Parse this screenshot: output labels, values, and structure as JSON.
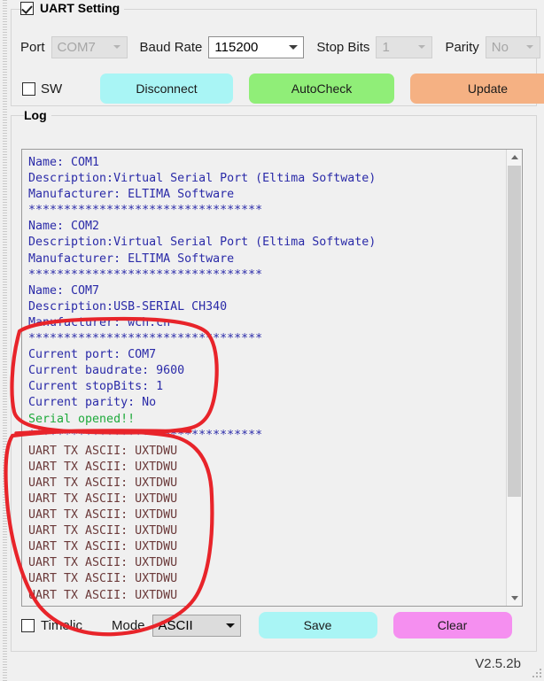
{
  "window": {
    "version_label": "V2.5.2b"
  },
  "uart_group": {
    "title": "UART Setting",
    "enabled_checkbox_checked": true,
    "fields": [
      {
        "label": "Port",
        "value": "COM7",
        "disabled": true,
        "name": "port"
      },
      {
        "label": "Baud Rate",
        "value": "115200",
        "disabled": false,
        "name": "baud-rate"
      },
      {
        "label": "Stop Bits",
        "value": "1",
        "disabled": true,
        "name": "stop-bits"
      },
      {
        "label": "Parity",
        "value": "No",
        "disabled": true,
        "name": "parity"
      }
    ],
    "sw_checkbox": {
      "label": "SW",
      "checked": false
    },
    "buttons": [
      {
        "label": "Disconnect",
        "color": "#a9f5f5"
      },
      {
        "label": "AutoCheck",
        "color": "#90ee78"
      },
      {
        "label": "Update",
        "color": "#f5b183"
      }
    ]
  },
  "log_group": {
    "title": "Log",
    "lines": [
      {
        "text": "Name: COM1",
        "color": "blue"
      },
      {
        "text": "Description:Virtual Serial Port (Eltima Softwate)",
        "color": "blue"
      },
      {
        "text": "Manufacturer: ELTIMA Software",
        "color": "blue"
      },
      {
        "text": "*********************************",
        "color": "blue"
      },
      {
        "text": "Name: COM2",
        "color": "blue"
      },
      {
        "text": "Description:Virtual Serial Port (Eltima Softwate)",
        "color": "blue"
      },
      {
        "text": "Manufacturer: ELTIMA Software",
        "color": "blue"
      },
      {
        "text": "*********************************",
        "color": "blue"
      },
      {
        "text": "Name: COM7",
        "color": "blue"
      },
      {
        "text": "Description:USB-SERIAL CH340",
        "color": "blue"
      },
      {
        "text": "Manufacturer: wch.cn",
        "color": "blue"
      },
      {
        "text": "*********************************",
        "color": "blue"
      },
      {
        "text": "Current port: COM7",
        "color": "blue"
      },
      {
        "text": "Current baudrate: 9600",
        "color": "blue"
      },
      {
        "text": "Current stopBits: 1",
        "color": "blue"
      },
      {
        "text": "Current parity: No",
        "color": "blue"
      },
      {
        "text": "Serial opened!!",
        "color": "green"
      },
      {
        "text": "*********************************",
        "color": "blue"
      },
      {
        "text": "UART TX ASCII: UXTDWU",
        "color": "tx"
      },
      {
        "text": "UART TX ASCII: UXTDWU",
        "color": "tx"
      },
      {
        "text": "UART TX ASCII: UXTDWU",
        "color": "tx"
      },
      {
        "text": "UART TX ASCII: UXTDWU",
        "color": "tx"
      },
      {
        "text": "UART TX ASCII: UXTDWU",
        "color": "tx"
      },
      {
        "text": "UART TX ASCII: UXTDWU",
        "color": "tx"
      },
      {
        "text": "UART TX ASCII: UXTDWU",
        "color": "tx"
      },
      {
        "text": "UART TX ASCII: UXTDWU",
        "color": "tx"
      },
      {
        "text": "UART TX ASCII: UXTDWU",
        "color": "tx"
      },
      {
        "text": "UART TX ASCII: UXTDWU",
        "color": "tx"
      },
      {
        "text": "UART TX ASCII: UXTDWU",
        "color": "tx"
      }
    ],
    "timeline_checkbox": {
      "label": "Timelic",
      "checked": false
    },
    "mode_label": "Mode",
    "mode_value": "ASCII",
    "save_label": "Save",
    "clear_label": "Clear"
  },
  "annotations": {
    "ink_color": "#e8242a",
    "shapes": "two hand-drawn red ellipses circling the 'Current port/baudrate/stopBits/parity + Serial opened!!' block and the 'UART TX ASCII: UXTDWU' block"
  }
}
